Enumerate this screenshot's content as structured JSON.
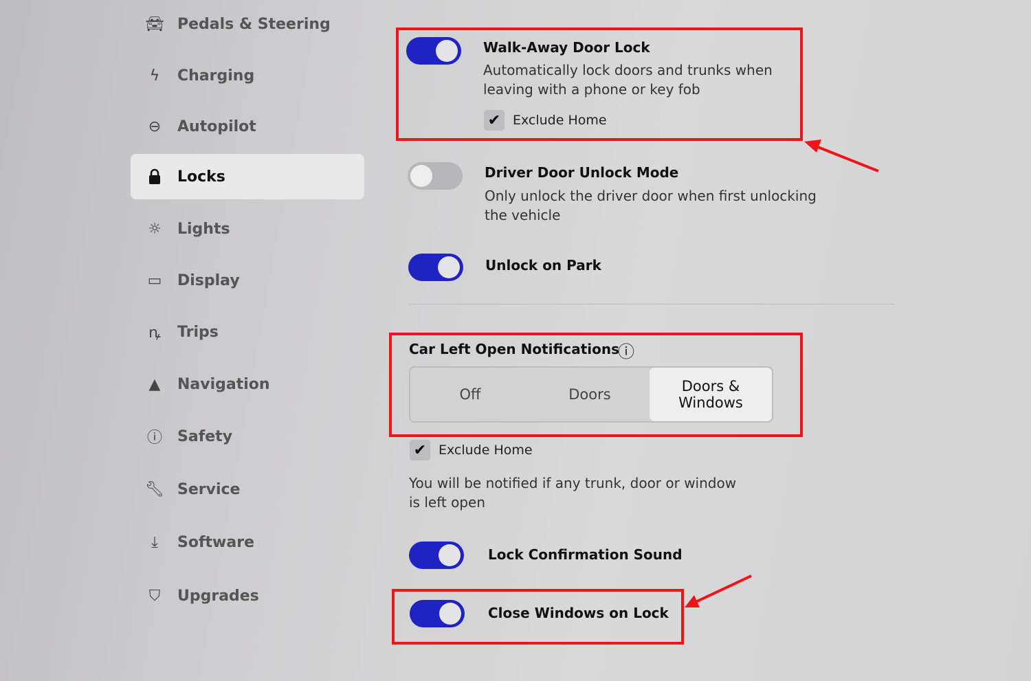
{
  "sidebar": {
    "items": [
      {
        "label": "Pedals & Steering",
        "icon": "car-icon"
      },
      {
        "label": "Charging",
        "icon": "lightning-icon"
      },
      {
        "label": "Autopilot",
        "icon": "steering-wheel-icon"
      },
      {
        "label": "Locks",
        "icon": "lock-icon",
        "active": true
      },
      {
        "label": "Lights",
        "icon": "sun-icon"
      },
      {
        "label": "Display",
        "icon": "display-icon"
      },
      {
        "label": "Trips",
        "icon": "trips-icon"
      },
      {
        "label": "Navigation",
        "icon": "navigation-arrow-icon"
      },
      {
        "label": "Safety",
        "icon": "alert-circle-icon"
      },
      {
        "label": "Service",
        "icon": "wrench-icon"
      },
      {
        "label": "Software",
        "icon": "download-icon"
      },
      {
        "label": "Upgrades",
        "icon": "shopping-bag-icon"
      }
    ]
  },
  "settings": {
    "walk_away": {
      "title": "Walk-Away Door Lock",
      "desc1": "Automatically lock doors and trunks when",
      "desc2": "leaving with a phone or key fob",
      "enabled": true,
      "exclude_home": {
        "label": "Exclude Home",
        "checked": true
      }
    },
    "driver_door": {
      "title": "Driver Door Unlock Mode",
      "desc1": "Only unlock the driver door when first unlocking",
      "desc2": "the vehicle",
      "enabled": false
    },
    "unlock_on_park": {
      "title": "Unlock on Park",
      "enabled": true
    },
    "car_left_open": {
      "title": "Car Left Open Notifications",
      "options": [
        "Off",
        "Doors",
        "Doors & Windows"
      ],
      "selected": "Doors & Windows",
      "exclude_home": {
        "label": "Exclude Home",
        "checked": true
      },
      "desc1": "You will be notified if any trunk, door or window",
      "desc2": "is left open"
    },
    "lock_sound": {
      "title": "Lock Confirmation Sound",
      "enabled": true
    },
    "close_windows": {
      "title": "Close Windows on Lock",
      "enabled": true
    }
  },
  "colors": {
    "toggle_on": "#1f23c2",
    "annotation": "#f0141a"
  }
}
